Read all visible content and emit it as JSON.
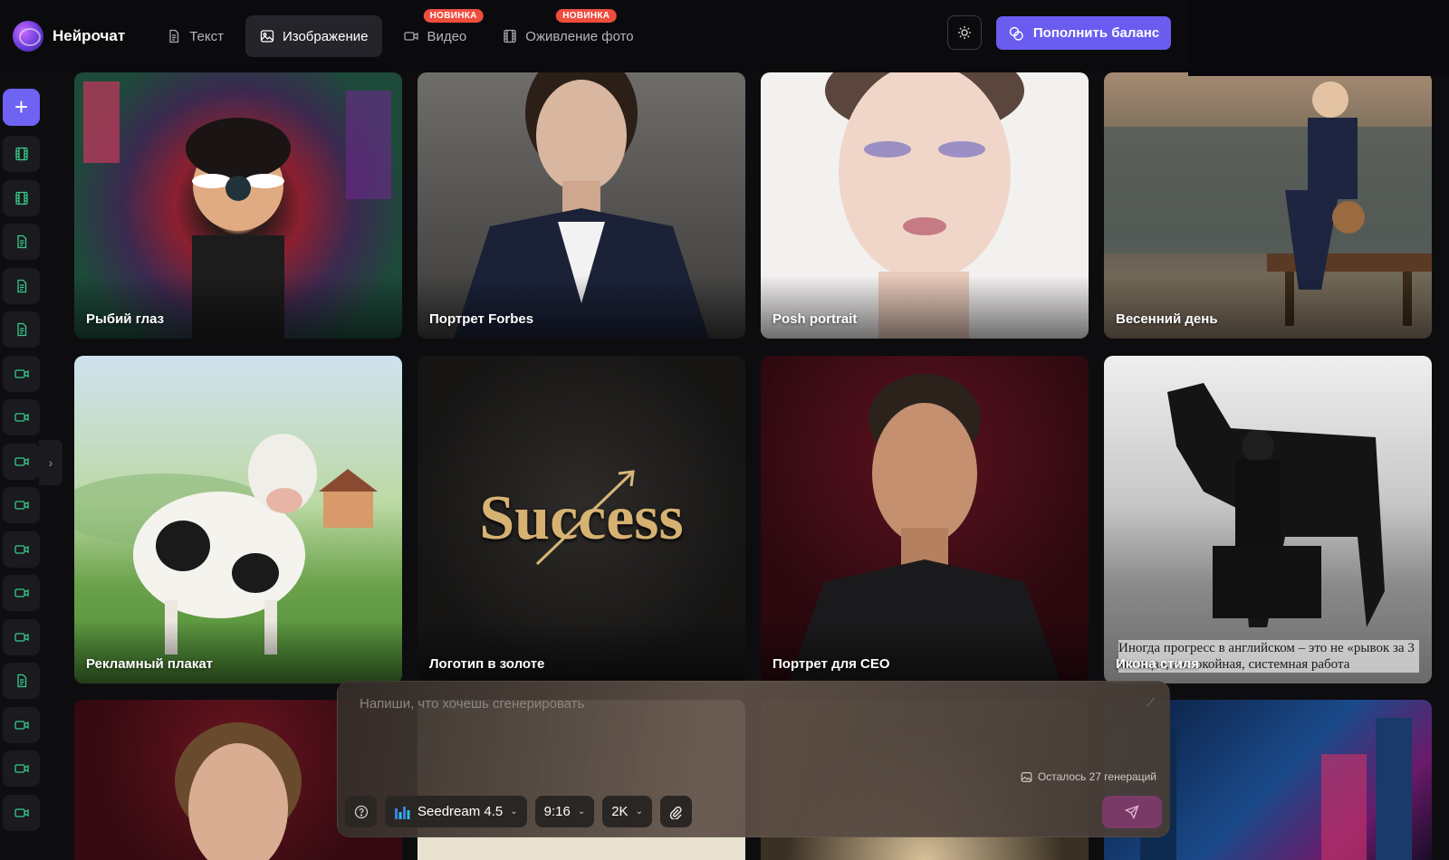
{
  "app": {
    "name": "Нейрочат"
  },
  "nav": {
    "tabs": [
      {
        "label": "Текст",
        "icon": "document-icon",
        "active": false,
        "badge": ""
      },
      {
        "label": "Изображение",
        "icon": "image-icon",
        "active": true,
        "badge": ""
      },
      {
        "label": "Видео",
        "icon": "video-icon",
        "active": false,
        "badge": "НОВИНКА"
      },
      {
        "label": "Оживление фото",
        "icon": "film-icon",
        "active": false,
        "badge": "НОВИНКА"
      }
    ]
  },
  "header": {
    "theme_icon": "sun-icon",
    "topup_label": "Пополнить баланс",
    "topup_color": "#6b5cf0"
  },
  "sidebar": {
    "new_chat_icon": "plus-icon",
    "items": [
      "film-icon",
      "film-icon",
      "document-icon",
      "document-icon",
      "document-icon",
      "video-icon",
      "video-icon",
      "video-icon",
      "video-icon",
      "video-icon",
      "video-icon",
      "video-icon",
      "document-icon",
      "video-icon",
      "video-icon",
      "video-icon"
    ]
  },
  "gallery": {
    "cards": [
      {
        "caption": "Рыбий глаз"
      },
      {
        "caption": "Портрет Forbes"
      },
      {
        "caption": "Posh portrait"
      },
      {
        "caption": "Весенний день"
      },
      {
        "caption": "Рекламный плакат"
      },
      {
        "caption": "Логотип в золоте",
        "logo_text": "Success"
      },
      {
        "caption": "Портрет для CEO"
      },
      {
        "caption": "Икона стиля",
        "overlay_text": "Иногда прогресс в английском – это не «рывок за 3 месяца», а спокойная, системная работа"
      },
      {
        "caption": ""
      },
      {
        "caption": ""
      },
      {
        "caption": ""
      },
      {
        "caption": ""
      }
    ]
  },
  "composer": {
    "placeholder": "Напиши, что хочешь сгенерировать",
    "remaining": "Осталось 27 генераций",
    "model": "Seedream 4.5",
    "ratio": "9:16",
    "quality": "2K"
  },
  "colors": {
    "accent": "#6b5cf0",
    "badge": "#ef4d3d",
    "background": "#0d0d10"
  }
}
